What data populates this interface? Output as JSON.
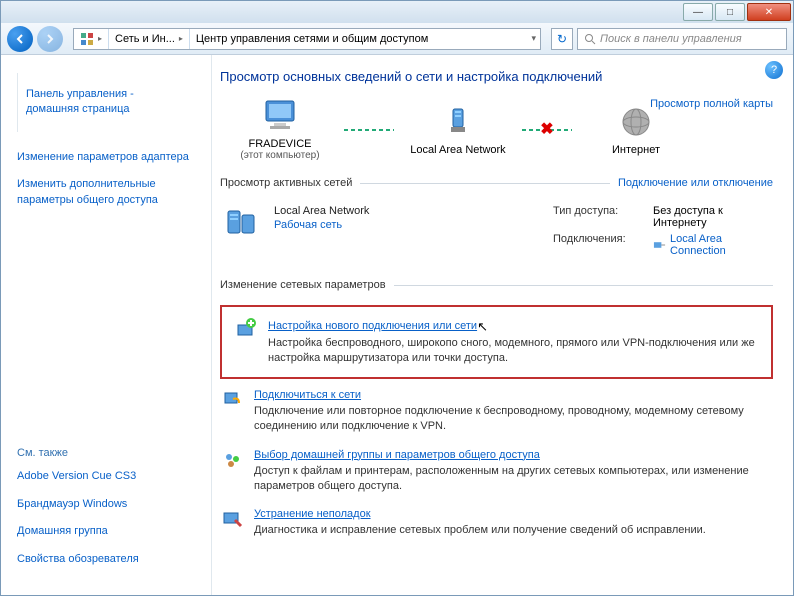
{
  "titlebar": {
    "min": "—",
    "max": "□",
    "close": "✕"
  },
  "nav": {
    "crumb1": "Сеть и Ин...",
    "crumb2": "Центр управления сетями и общим доступом",
    "search_placeholder": "Поиск в панели управления"
  },
  "sidebar": {
    "home": "Панель управления - домашняя страница",
    "link1": "Изменение параметров адаптера",
    "link2": "Изменить дополнительные параметры общего доступа",
    "seealso_hdr": "См. также",
    "see1": "Adobe Version Cue CS3",
    "see2": "Брандмауэр Windows",
    "see3": "Домашняя группа",
    "see4": "Свойства обозревателя"
  },
  "main": {
    "heading": "Просмотр основных сведений о сети и настройка подключений",
    "fullmap": "Просмотр полной карты",
    "map": {
      "comp": "FRADEVICE",
      "compsub": "(этот компьютер)",
      "lan": "Local Area Network",
      "inet": "Интернет"
    },
    "active_hdr": "Просмотр активных сетей",
    "connect_toggle": "Подключение или отключение",
    "conn": {
      "name": "Local Area Network",
      "type": "Рабочая сеть",
      "access_lbl": "Тип доступа:",
      "access_val": "Без доступа к Интернету",
      "conn_lbl": "Подключения:",
      "conn_val": "Local Area Connection"
    },
    "change_hdr": "Изменение сетевых параметров",
    "act1": {
      "title": "Настройка нового подключения или сети",
      "desc": "Настройка беспроводного, широкопо      сного, модемного, прямого или VPN-подключения или же настройка маршрутизатора или точки доступа."
    },
    "act2": {
      "title": "Подключиться к сети",
      "desc": "Подключение или повторное подключение к беспроводному, проводному, модемному сетевому соединению или подключение к VPN."
    },
    "act3": {
      "title": "Выбор домашней группы и параметров общего доступа",
      "desc": "Доступ к файлам и принтерам, расположенным на других сетевых компьютерах, или изменение параметров общего доступа."
    },
    "act4": {
      "title": "Устранение неполадок",
      "desc": "Диагностика и исправление сетевых проблем или получение сведений об исправлении."
    }
  }
}
